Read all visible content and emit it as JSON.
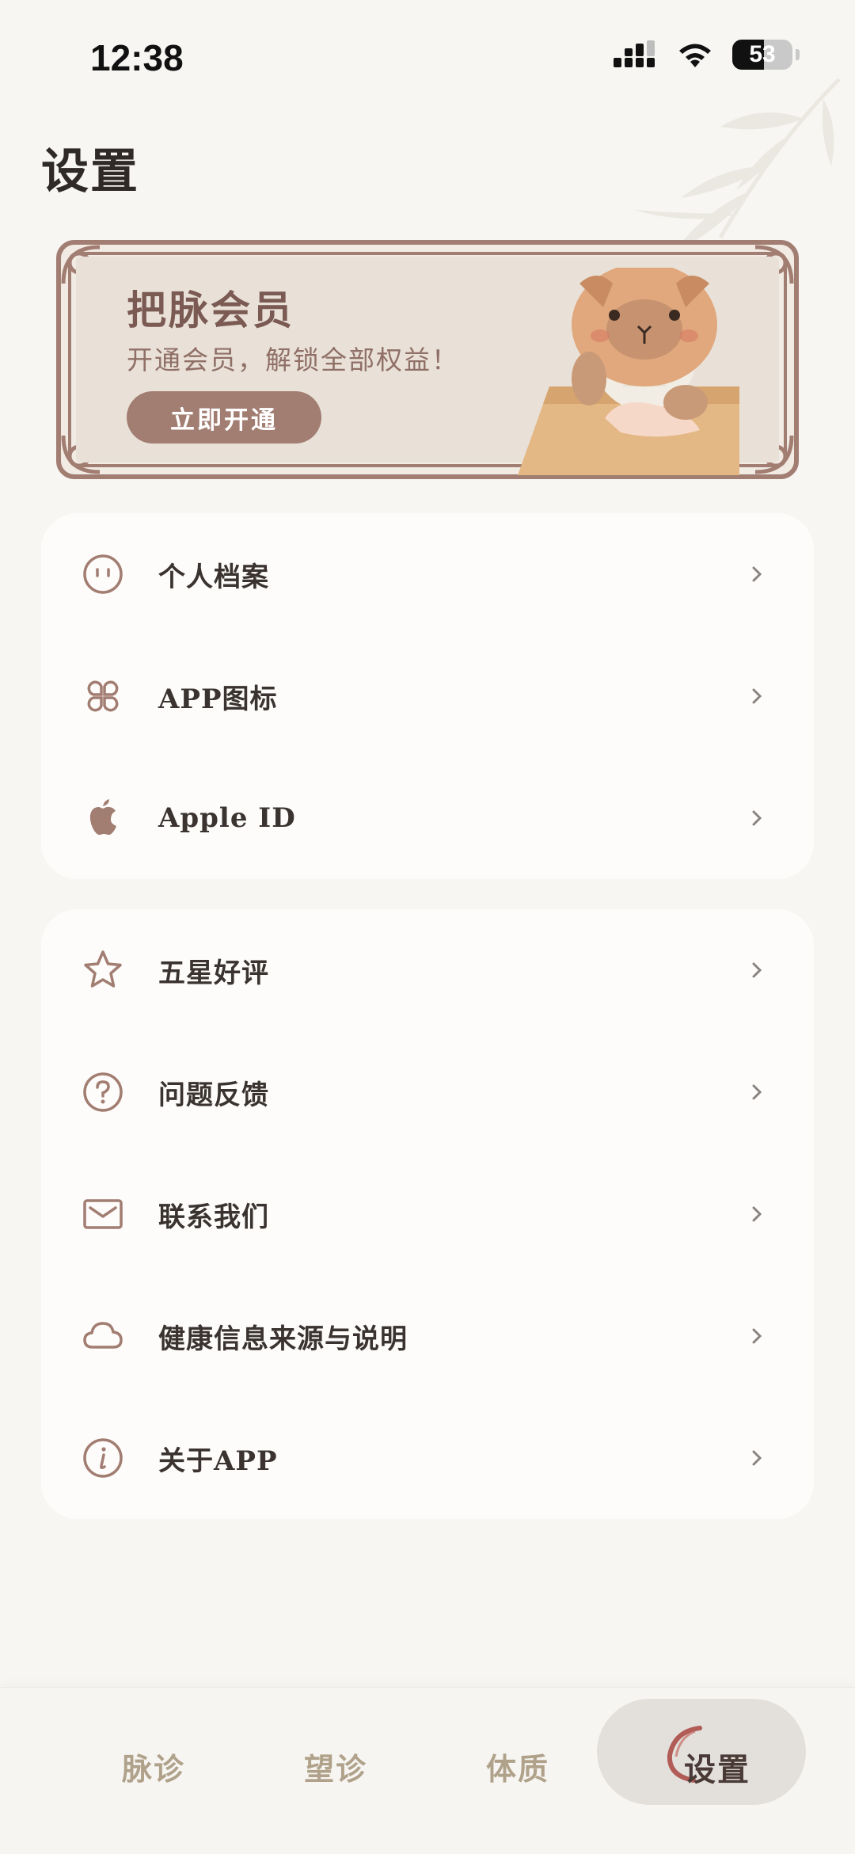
{
  "status_bar": {
    "time": "12:38",
    "battery_level": "53",
    "battery_fraction": 0.53
  },
  "page": {
    "title": "设置"
  },
  "banner": {
    "title": "把脉会员",
    "subtitle": "开通会员，解锁全部权益！",
    "button_label": "立即开通"
  },
  "account_section": {
    "items": [
      {
        "label": "个人档案",
        "icon": "smiley-face-icon"
      },
      {
        "label": "APP图标",
        "icon": "app-grid-icon"
      },
      {
        "label": "Apple ID",
        "icon": "apple-logo-icon"
      }
    ]
  },
  "support_section": {
    "items": [
      {
        "label": "五星好评",
        "icon": "star-icon"
      },
      {
        "label": "问题反馈",
        "icon": "question-icon"
      },
      {
        "label": "联系我们",
        "icon": "mail-icon"
      },
      {
        "label": "健康信息来源与说明",
        "icon": "cloud-icon"
      },
      {
        "label": "关于APP",
        "icon": "info-icon"
      }
    ]
  },
  "tabbar": {
    "tabs": [
      {
        "label": "脉诊"
      },
      {
        "label": "望诊"
      },
      {
        "label": "体质"
      },
      {
        "label": "设置",
        "active": true
      }
    ]
  },
  "colors": {
    "background": "#f7f6f3",
    "card": "#fdfcfa",
    "accent": "#a27d72",
    "icon": "#a27d72",
    "tab_inactive": "#b0a28a",
    "tab_active_pill": "#e3e0dc"
  }
}
